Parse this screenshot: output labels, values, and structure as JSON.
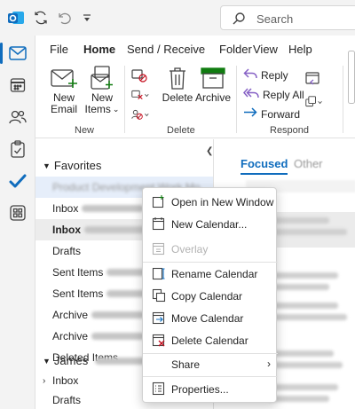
{
  "titlebar": {
    "search_placeholder": "Search"
  },
  "ribbon_tabs": [
    "File",
    "Home",
    "Send / Receive",
    "Folder",
    "View",
    "Help"
  ],
  "ribbon": {
    "new_email": [
      "New",
      "Email"
    ],
    "new_items": [
      "New",
      "Items"
    ],
    "new_group": "New",
    "delete_label": "Delete",
    "archive_label": "Archive",
    "delete_group": "Delete",
    "reply": "Reply",
    "reply_all": "Reply All",
    "forward": "Forward",
    "respond_group": "Respond"
  },
  "folders": {
    "favorites_header": "Favorites",
    "items": [
      {
        "label": "Product Development Work Mo",
        "blur": false
      },
      {
        "label": "Inbox",
        "blur": true
      },
      {
        "label": "Inbox",
        "blur": true
      },
      {
        "label": "Drafts",
        "blur": false
      },
      {
        "label": "Sent Items",
        "blur": true
      },
      {
        "label": "Sent Items",
        "blur": true
      },
      {
        "label": "Archive",
        "blur": true
      },
      {
        "label": "Archive",
        "blur": true
      },
      {
        "label": "Deleted Items",
        "blur": false
      }
    ],
    "account_header": "James",
    "account_items": [
      "Inbox",
      "Drafts"
    ]
  },
  "message_list": {
    "tab_focused": "Focused",
    "tab_other": "Other"
  },
  "context_menu": {
    "items": [
      {
        "label": "Open in New Window",
        "icon": "new-window-icon",
        "disabled": false
      },
      {
        "label": "New Calendar...",
        "icon": "calendar-icon",
        "disabled": false
      },
      {
        "label": "Overlay",
        "icon": "overlay-icon",
        "disabled": true
      },
      {
        "label": "Rename Calendar",
        "icon": "rename-icon",
        "disabled": false
      },
      {
        "label": "Copy Calendar",
        "icon": "copy-icon",
        "disabled": false
      },
      {
        "label": "Move Calendar",
        "icon": "move-icon",
        "disabled": false
      },
      {
        "label": "Delete Calendar",
        "icon": "delete-calendar-icon",
        "disabled": false
      },
      {
        "label": "Share",
        "icon": "",
        "disabled": false
      },
      {
        "label": "Properties...",
        "icon": "properties-icon",
        "disabled": false
      }
    ]
  },
  "colors": {
    "accent": "#0f6cbd",
    "delete_red": "#c50f1f",
    "archive_green": "#107c10"
  }
}
